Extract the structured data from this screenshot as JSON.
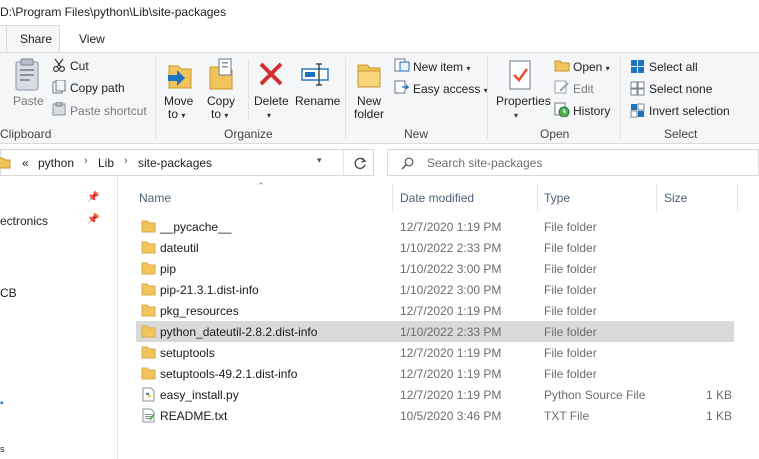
{
  "window": {
    "title": "D:\\Program Files\\python\\Lib\\site-packages"
  },
  "tabs": [
    {
      "label": "Share"
    },
    {
      "label": "View"
    }
  ],
  "ribbon": {
    "clipboard": {
      "label": "Clipboard",
      "paste": "Paste",
      "cut": "Cut",
      "copy_path": "Copy path",
      "paste_shortcut": "Paste shortcut"
    },
    "organize": {
      "label": "Organize",
      "move_to": "Move",
      "move_to2": "to",
      "copy_to": "Copy",
      "copy_to2": "to",
      "delete": "Delete",
      "rename": "Rename"
    },
    "new": {
      "label": "New",
      "new_folder": "New",
      "new_folder2": "folder",
      "new_item": "New item",
      "easy_access": "Easy access"
    },
    "open": {
      "label": "Open",
      "properties": "Properties",
      "open": "Open",
      "edit": "Edit",
      "history": "History"
    },
    "select": {
      "label": "Select",
      "select_all": "Select all",
      "select_none": "Select none",
      "invert_selection": "Invert selection"
    }
  },
  "address": {
    "overflow": "«",
    "crumbs": [
      "python",
      "Lib",
      "site-packages"
    ]
  },
  "search": {
    "placeholder": "Search site-packages"
  },
  "nav": [
    {
      "label": "ectronics"
    },
    {
      "label": "CB"
    }
  ],
  "columns": {
    "name": "Name",
    "date": "Date modified",
    "type": "Type",
    "size": "Size"
  },
  "files": [
    {
      "name": "__pycache__",
      "date": "12/7/2020 1:19 PM",
      "type": "File folder",
      "size": "",
      "icon": "folder-icon"
    },
    {
      "name": "dateutil",
      "date": "1/10/2022 2:33 PM",
      "type": "File folder",
      "size": "",
      "icon": "folder-icon"
    },
    {
      "name": "pip",
      "date": "1/10/2022 3:00 PM",
      "type": "File folder",
      "size": "",
      "icon": "folder-icon"
    },
    {
      "name": "pip-21.3.1.dist-info",
      "date": "1/10/2022 3:00 PM",
      "type": "File folder",
      "size": "",
      "icon": "folder-icon"
    },
    {
      "name": "pkg_resources",
      "date": "12/7/2020 1:19 PM",
      "type": "File folder",
      "size": "",
      "icon": "folder-icon"
    },
    {
      "name": "python_dateutil-2.8.2.dist-info",
      "date": "1/10/2022 2:33 PM",
      "type": "File folder",
      "size": "",
      "icon": "folder-icon"
    },
    {
      "name": "setuptools",
      "date": "12/7/2020 1:19 PM",
      "type": "File folder",
      "size": "",
      "icon": "folder-icon"
    },
    {
      "name": "setuptools-49.2.1.dist-info",
      "date": "12/7/2020 1:19 PM",
      "type": "File folder",
      "size": "",
      "icon": "folder-icon"
    },
    {
      "name": "easy_install.py",
      "date": "12/7/2020 1:19 PM",
      "type": "Python Source File",
      "size": "1 KB",
      "icon": "python-file-icon"
    },
    {
      "name": "README.txt",
      "date": "10/5/2020 3:46 PM",
      "type": "TXT File",
      "size": "1 KB",
      "icon": "text-file-icon"
    }
  ],
  "colors": {
    "folder": "#f2c55c",
    "selection": "#d9d9d9",
    "header_text": "#4c607a",
    "accent_blue": "#1e73be",
    "delete_red": "#d32f2f"
  }
}
